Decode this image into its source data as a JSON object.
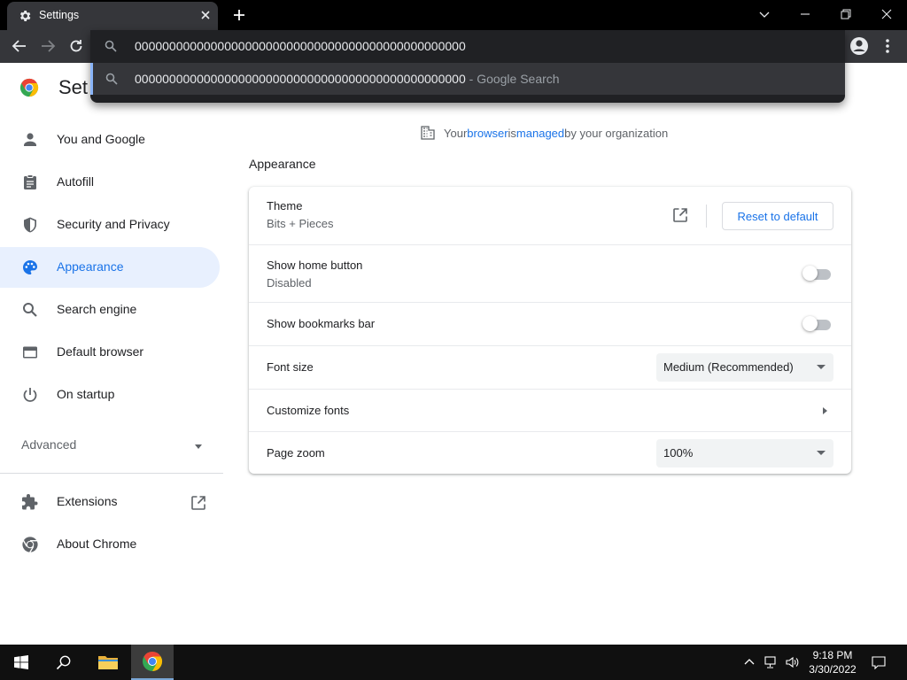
{
  "window": {
    "tab_title": "Settings"
  },
  "omnibox": {
    "input_value": "000000000000000000000000000000000000000000000000",
    "suggestion_text": "000000000000000000000000000000000000000000000000",
    "suggestion_separator": " - ",
    "suggestion_source": "Google Search"
  },
  "settings": {
    "title": "Settings",
    "visible_title": "Set"
  },
  "sidebar": {
    "items": [
      {
        "label": "You and Google",
        "icon": "person-icon"
      },
      {
        "label": "Autofill",
        "icon": "clipboard-icon"
      },
      {
        "label": "Security and Privacy",
        "icon": "shield-icon"
      },
      {
        "label": "Appearance",
        "icon": "palette-icon",
        "active": true
      },
      {
        "label": "Search engine",
        "icon": "search-icon"
      },
      {
        "label": "Default browser",
        "icon": "browser-window-icon"
      },
      {
        "label": "On startup",
        "icon": "power-icon"
      }
    ],
    "advanced_label": "Advanced",
    "extensions_label": "Extensions",
    "about_label": "About Chrome"
  },
  "managed_notice": {
    "prefix": "Your ",
    "link1": "browser",
    "middle": " is ",
    "link2": "managed",
    "suffix": " by your organization"
  },
  "appearance": {
    "section_title": "Appearance",
    "theme_label": "Theme",
    "theme_value": "Bits + Pieces",
    "reset_label": "Reset to default",
    "home_button_label": "Show home button",
    "home_button_sub": "Disabled",
    "home_button_enabled": false,
    "bookmarks_bar_label": "Show bookmarks bar",
    "bookmarks_bar_enabled": false,
    "font_size_label": "Font size",
    "font_size_value": "Medium (Recommended)",
    "customize_fonts_label": "Customize fonts",
    "page_zoom_label": "Page zoom",
    "page_zoom_value": "100%"
  },
  "taskbar": {
    "time": "9:18 PM",
    "date": "3/30/2022"
  },
  "colors": {
    "accent": "#1a73e8",
    "active_nav_bg": "#e8f0fe",
    "toolbar": "#35363a",
    "omnibox": "#202124"
  }
}
